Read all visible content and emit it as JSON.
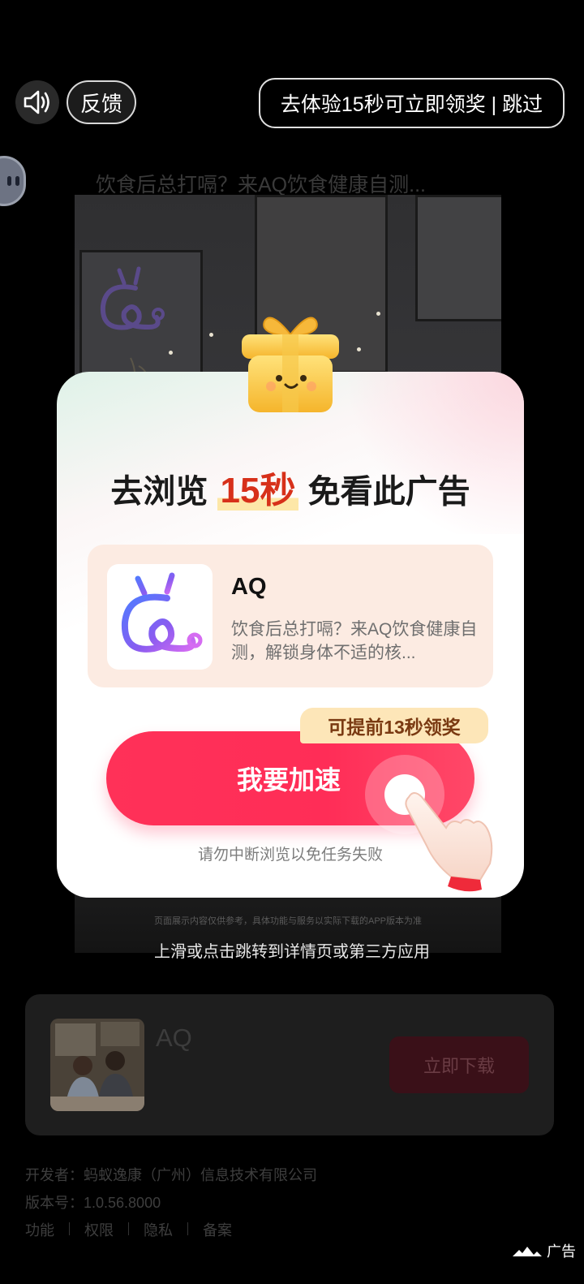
{
  "topbar": {
    "sound_icon": "speaker-icon",
    "feedback_label": "反馈",
    "skip_label": "去体验15秒可立即领奖 | 跳过"
  },
  "background_ad": {
    "headline": "饮食后总打嗝？来AQ饮食健康自测...",
    "disclaimer": "页面展示内容仅供参考，具体功能与服务以实际下载的APP版本为准",
    "swipe_hint": "上滑或点击跳转到详情页或第三方应用",
    "card": {
      "app_name": "AQ",
      "download_label": "立即下载"
    },
    "developer": "开发者：蚂蚁逸康（广州）信息技术有限公司",
    "version": "版本号：1.0.56.8000",
    "links": [
      "功能",
      "权限",
      "隐私",
      "备案"
    ],
    "ad_mark": "广告"
  },
  "modal": {
    "title_prefix": "去浏览",
    "title_highlight": "15秒",
    "title_suffix": "免看此广告",
    "app": {
      "name": "AQ",
      "description": "饮食后总打嗝？来AQ饮食健康自测，解锁身体不适的核..."
    },
    "early_badge": "可提前13秒领奖",
    "speed_button": "我要加速",
    "hint": "请勿中断浏览以免任务失败"
  },
  "colors": {
    "accent": "#ff2d57",
    "highlight": "#d7301a",
    "badge_bg": "#fde6b8",
    "card_bg": "#fcebe2"
  }
}
